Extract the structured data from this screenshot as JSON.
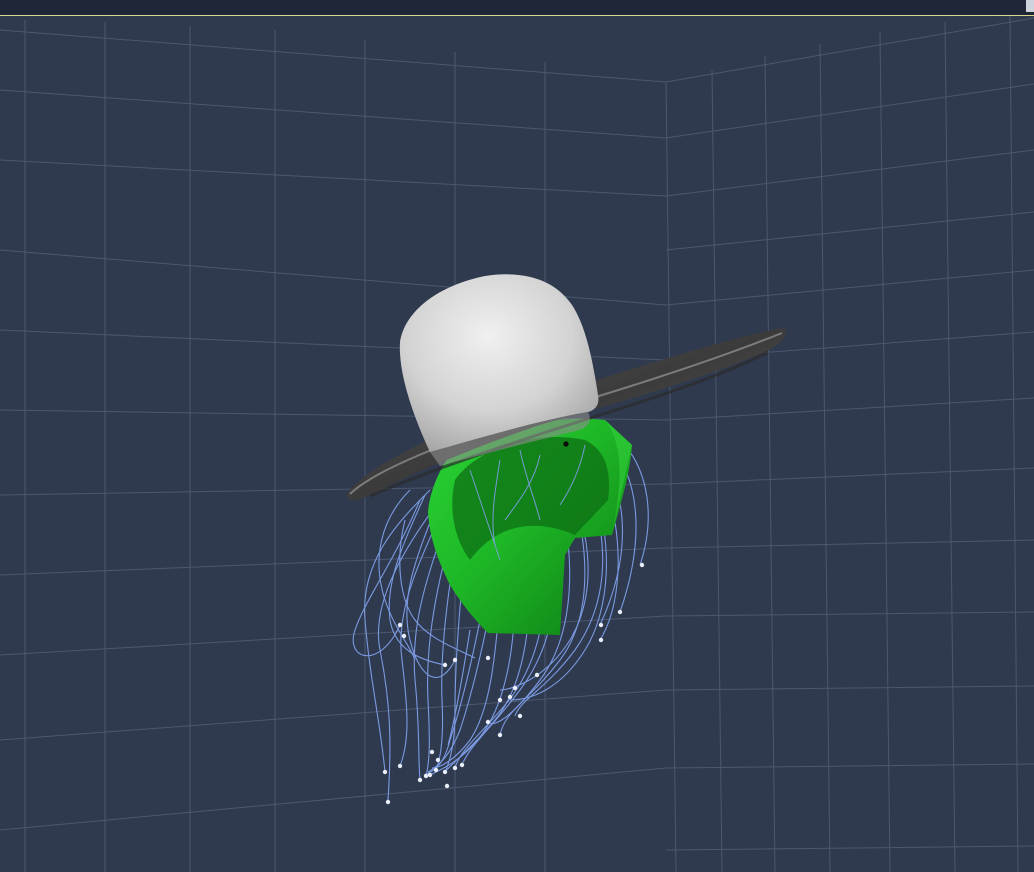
{
  "window": {
    "title": ""
  },
  "viewport": {
    "background_color": "#2f3a4f",
    "grid_color": "#4b5870",
    "objects": [
      {
        "name": "hat",
        "color": "#cfcfcf",
        "brim_color": "#4a4a4a"
      },
      {
        "name": "head-proxy",
        "color": "#22c22a"
      },
      {
        "name": "hair-guide-curves",
        "color": "#7f9fe8",
        "point_color": "#e9eef8"
      }
    ]
  }
}
